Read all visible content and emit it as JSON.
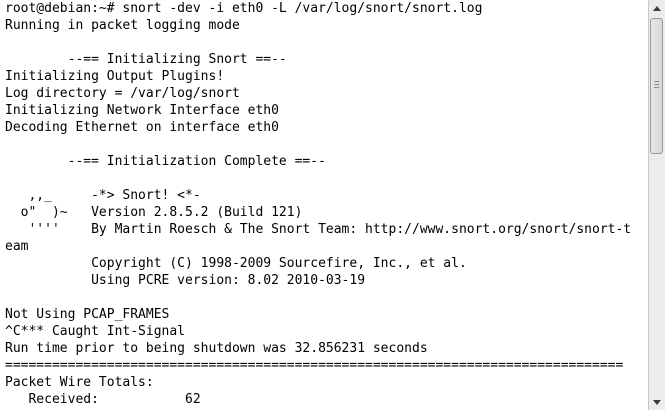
{
  "terminal": {
    "lines": [
      "root@debian:~# snort -dev -i eth0 -L /var/log/snort/snort.log",
      "Running in packet logging mode",
      "",
      "        --== Initializing Snort ==--",
      "Initializing Output Plugins!",
      "Log directory = /var/log/snort",
      "Initializing Network Interface eth0",
      "Decoding Ethernet on interface eth0",
      "",
      "        --== Initialization Complete ==--",
      "",
      "   ,,_     -*> Snort! <*-",
      "  o\"  )~   Version 2.8.5.2 (Build 121)",
      "   ''''    By Martin Roesch & The Snort Team: http://www.snort.org/snort/snort-t",
      "eam",
      "           Copyright (C) 1998-2009 Sourcefire, Inc., et al.",
      "           Using PCRE version: 8.02 2010-03-19",
      "",
      "Not Using PCAP_FRAMES",
      "^C*** Caught Int-Signal",
      "Run time prior to being shutdown was 32.856231 seconds",
      "===============================================================================",
      "Packet Wire Totals:",
      "   Received:           62"
    ]
  },
  "scrollbar": {
    "icons": {
      "up": "triangle-up-icon",
      "down": "triangle-down-icon"
    }
  }
}
